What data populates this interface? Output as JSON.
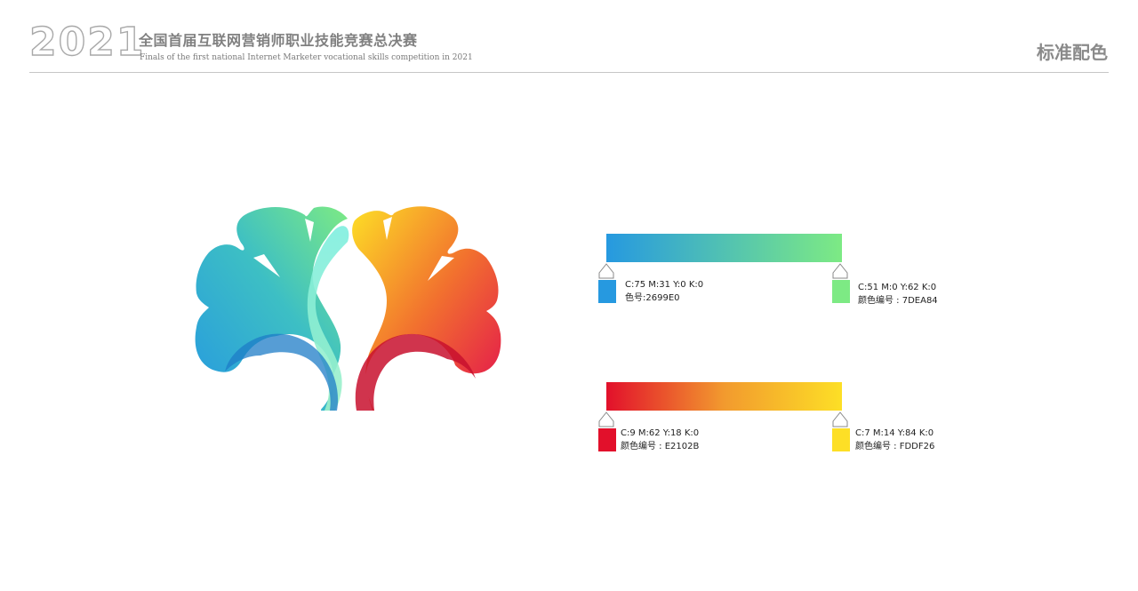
{
  "header": {
    "year": "2021",
    "title_cn": "全国首届互联网营销师职业技能竞赛总决赛",
    "title_en": "Finals of the first national Internet Marketer vocational skills competition in 2021",
    "page_label": "标准配色"
  },
  "colors": {
    "blue": "#2699E0",
    "green": "#7DEA84",
    "red": "#E2102B",
    "yellow": "#FDDF26"
  },
  "gradients": [
    {
      "start": {
        "cmyk": "C:75 M:31 Y:0 K:0",
        "code": "色号:2699E0"
      },
      "end": {
        "cmyk": "C:51 M:0 Y:62 K:0",
        "code": "颜色编号 : 7DEA84"
      }
    },
    {
      "start": {
        "cmyk": "C:9 M:62 Y:18 K:0",
        "code": "颜色编号 : E2102B"
      },
      "end": {
        "cmyk": "C:7 M:14 Y:84 K:0",
        "code": "颜色编号 : FDDF26"
      }
    }
  ]
}
